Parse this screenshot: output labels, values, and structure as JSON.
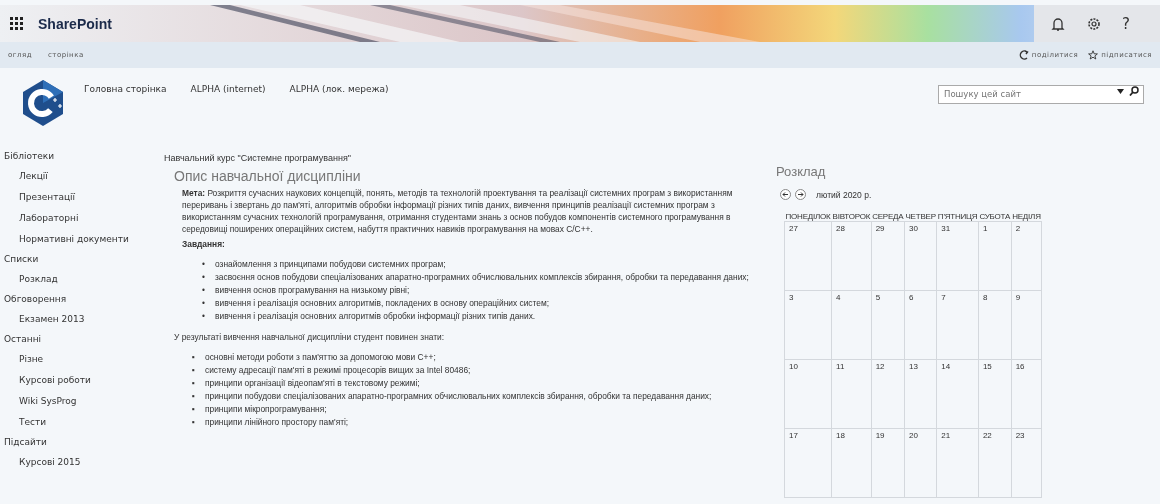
{
  "suite_bar": {
    "app_name": "SharePoint",
    "help_label": "?"
  },
  "ribbon": {
    "tabs": [
      {
        "label": "огляд",
        "selected": false
      },
      {
        "label": "сторінка",
        "selected": false
      }
    ],
    "actions": [
      {
        "kind": "share",
        "label": "поділитися"
      },
      {
        "kind": "follow",
        "label": "підписатися"
      }
    ]
  },
  "top_nav": {
    "links": [
      "Головна сторінка",
      "ALPHA (internet)",
      "ALPHA (лок. мережа)"
    ]
  },
  "search": {
    "placeholder": "Пошуку цей сайт"
  },
  "sidebar": {
    "items": [
      {
        "label": "Бібліотеки",
        "children": [
          {
            "label": "Лекції"
          },
          {
            "label": "Презентації"
          },
          {
            "label": "Лабораторні"
          },
          {
            "label": "Нормативні документи"
          }
        ]
      },
      {
        "label": "Списки",
        "children": [
          {
            "label": "Розклад"
          }
        ]
      },
      {
        "label": "Обговорення",
        "children": [
          {
            "label": "Екзамен 2013"
          }
        ]
      },
      {
        "label": "Останні",
        "children": [
          {
            "label": "Різне"
          },
          {
            "label": "Курсові роботи"
          },
          {
            "label": "Wiki SysProg"
          },
          {
            "label": "Тести"
          }
        ]
      },
      {
        "label": "Підсайти",
        "children": [
          {
            "label": "Курсові 2015"
          }
        ]
      }
    ]
  },
  "course": {
    "breadcrumb": "Навчальний курс \"Системне програмування\"",
    "title": "Опис навчальної дисципліни",
    "goal": "**Мета:** Розкриття сучасних наукових концепцій, понять, методів та технологій проектування та реалізації системних програм з використанням переривань і звертань до пам'яті, алгоритмів обробки інформації різних типів даних, вивчення принципів реалізації системних програм з використанням сучасних технологій програмування, отримання студентами знань з основ побудов компонентів системного програмування в середовищі поширених операційних систем, набуття практичних навиків програмування на мовах С/С++.",
    "tasks_heading": "Завдання:",
    "tasks": [
      {
        "marker": "•",
        "text": "ознайомлення з принципами побудови системних програм;"
      },
      {
        "marker": "•",
        "text": "засвоєння основ побудови спеціалізованих апаратно-програмних обчислювальних комплексів збирання, обробки та передавання даних;"
      },
      {
        "marker": "•",
        "text": "вивчення основ програмування на низькому рівні;"
      },
      {
        "marker": "•",
        "text": "вивчення і реалізація основних алгоритмів, покладених в основу операційних систем;"
      },
      {
        "marker": "•",
        "text": "вивчення і реалізація основних алгоритмів обробки інформації різних типів даних."
      }
    ],
    "outcomes_intro": "У результаті вивчення навчальної дисципліни студент повинен знати:",
    "outcomes": [
      {
        "marker": "▪",
        "text": "основні методи роботи з пам'яттю за допомогою мови С++;"
      },
      {
        "marker": "▪",
        "text": "систему адресації пам'яті в режимі процесорів вищих за Intel 80486;"
      },
      {
        "marker": "▪",
        "text": "принципи організації відеопам'яті в текстовому режимі;"
      },
      {
        "marker": "▪",
        "text": "принципи побудови спеціалізованих апаратно-програмних обчислювальних комплексів збирання, обробки та передавання даних;"
      },
      {
        "marker": "▪",
        "text": "принципи мікропрограмування;"
      },
      {
        "marker": "▪",
        "text": "принципи лінійного простору пам'яті;"
      }
    ]
  },
  "schedule": {
    "title": "Розклад",
    "month": "лютий 2020 р.",
    "weekdays": [
      "ПОНЕДІЛОК",
      "ВІВТОРОК",
      "СЕРЕДА",
      "ЧЕТВЕР",
      "П'ЯТНИЦЯ",
      "СУБОТА",
      "НЕДІЛЯ"
    ],
    "weeks": [
      [
        "27",
        "28",
        "29",
        "30",
        "31",
        "1",
        "2"
      ],
      [
        "3",
        "4",
        "5",
        "6",
        "7",
        "8",
        "9"
      ],
      [
        "10",
        "11",
        "12",
        "13",
        "14",
        "15",
        "16"
      ],
      [
        "17",
        "18",
        "19",
        "20",
        "21",
        "22",
        "23"
      ]
    ]
  }
}
